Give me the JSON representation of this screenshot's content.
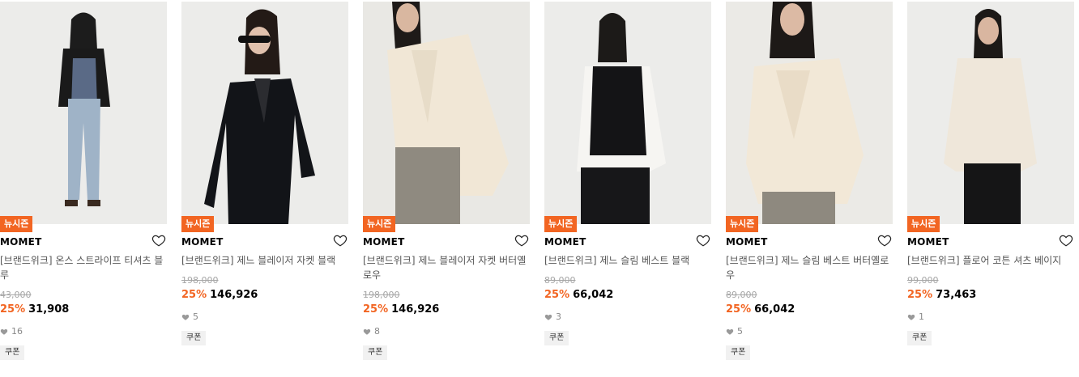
{
  "badge_color": "#f26522",
  "products": [
    {
      "badge": "뉴시즌",
      "brand": "MOMET",
      "title": "[브랜드위크] 온스 스트라이프 티셔츠 블루",
      "original_price": "43,000",
      "discount": "25%",
      "price": "31,908",
      "likes": "16",
      "coupon": "쿠폰",
      "lines": 2
    },
    {
      "badge": "뉴시즌",
      "brand": "MOMET",
      "title": "[브랜드위크] 제느 블레이저 자켓 블랙",
      "original_price": "198,000",
      "discount": "25%",
      "price": "146,926",
      "likes": "5",
      "coupon": "쿠폰",
      "lines": 1
    },
    {
      "badge": "뉴시즌",
      "brand": "MOMET",
      "title": "[브랜드위크] 제느 블레이저 자켓 버터옐로우",
      "original_price": "198,000",
      "discount": "25%",
      "price": "146,926",
      "likes": "8",
      "coupon": "쿠폰",
      "lines": 2
    },
    {
      "badge": "뉴시즌",
      "brand": "MOMET",
      "title": "[브랜드위크] 제느 슬림 베스트 블랙",
      "original_price": "89,000",
      "discount": "25%",
      "price": "66,042",
      "likes": "3",
      "coupon": "쿠폰",
      "lines": 1
    },
    {
      "badge": "뉴시즌",
      "brand": "MOMET",
      "title": "[브랜드위크] 제느 슬림 베스트 버터옐로우",
      "original_price": "89,000",
      "discount": "25%",
      "price": "66,042",
      "likes": "5",
      "coupon": "쿠폰",
      "lines": 2
    },
    {
      "badge": "뉴시즌",
      "brand": "MOMET",
      "title": "[브랜드위크] 플로어 코튼 셔츠 베이지",
      "original_price": "99,000",
      "discount": "25%",
      "price": "73,463",
      "likes": "1",
      "coupon": "쿠폰",
      "lines": 1
    }
  ]
}
